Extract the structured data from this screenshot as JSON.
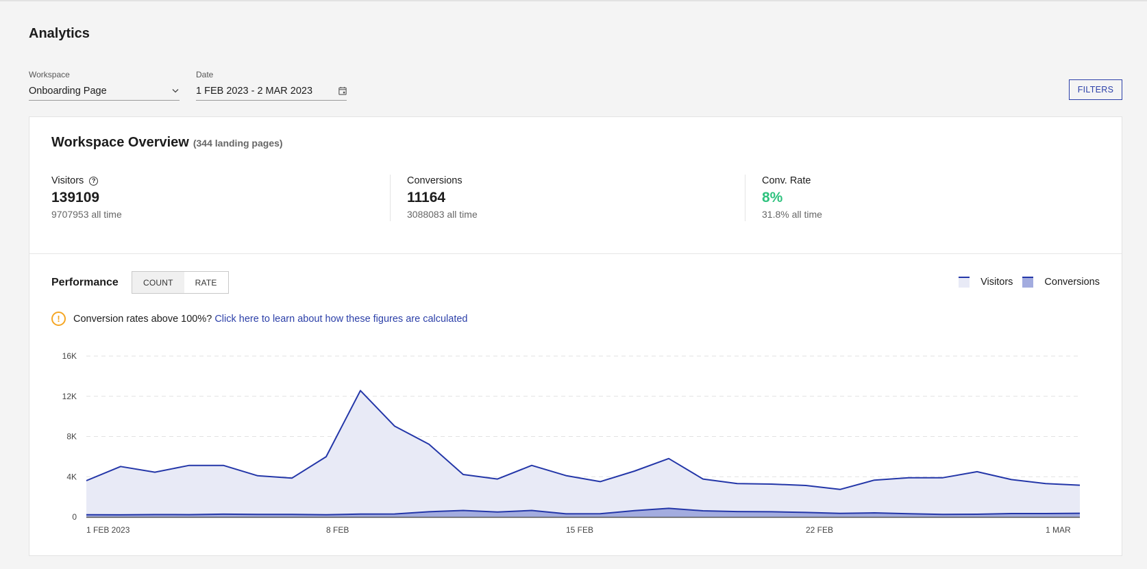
{
  "header": {
    "title": "Analytics"
  },
  "filters": {
    "workspace": {
      "label": "Workspace",
      "value": "Onboarding Page",
      "icon": "chevron-down-icon"
    },
    "date": {
      "label": "Date",
      "value": "1 FEB 2023 - 2 MAR 2023",
      "icon": "calendar-icon"
    },
    "filters_button": "FILTERS"
  },
  "overview": {
    "title": "Workspace Overview",
    "subtitle": "(344 landing pages)",
    "stats": [
      {
        "label": "Visitors",
        "value": "139109",
        "sub": "9707953 all time",
        "has_help": true
      },
      {
        "label": "Conversions",
        "value": "11164",
        "sub": "3088083 all time",
        "has_help": false
      },
      {
        "label": "Conv. Rate",
        "value": "8%",
        "sub": "31.8% all time",
        "has_help": false,
        "value_color": "#2ec27e"
      }
    ]
  },
  "performance": {
    "title": "Performance",
    "toggle": [
      {
        "label": "COUNT",
        "active": true
      },
      {
        "label": "RATE",
        "active": false
      }
    ],
    "legend": [
      {
        "label": "Visitors",
        "fill": "#e8eaf6",
        "stroke": "#2336a8"
      },
      {
        "label": "Conversions",
        "fill": "#a3acdf",
        "stroke": "#2336a8"
      }
    ],
    "warning": {
      "text": "Conversion rates above 100%?",
      "link": "Click here to learn about how these figures are calculated"
    }
  },
  "chart_data": {
    "type": "area",
    "title": "",
    "xlabel": "",
    "ylabel": "",
    "x": [
      "1 Feb",
      "2 Feb",
      "3 Feb",
      "4 Feb",
      "5 Feb",
      "6 Feb",
      "7 Feb",
      "8 Feb",
      "9 Feb",
      "10 Feb",
      "11 Feb",
      "12 Feb",
      "13 Feb",
      "14 Feb",
      "15 Feb",
      "16 Feb",
      "17 Feb",
      "18 Feb",
      "19 Feb",
      "20 Feb",
      "21 Feb",
      "22 Feb",
      "23 Feb",
      "24 Feb",
      "25 Feb",
      "26 Feb",
      "27 Feb",
      "28 Feb",
      "1 Mar",
      "2 Mar"
    ],
    "x_tick_labels": [
      {
        "index": 0,
        "label": "1 FEB 2023"
      },
      {
        "index": 7,
        "label": "8 FEB"
      },
      {
        "index": 14,
        "label": "15 FEB"
      },
      {
        "index": 21,
        "label": "22 FEB"
      },
      {
        "index": 28,
        "label": "1 MAR"
      }
    ],
    "y_ticks": [
      0,
      4000,
      8000,
      12000,
      16000
    ],
    "y_tick_labels": [
      "0",
      "4K",
      "8K",
      "12K",
      "16K"
    ],
    "ylim": [
      0,
      16000
    ],
    "grid": true,
    "legend_position": "top-right",
    "series": [
      {
        "name": "Visitors",
        "values": [
          3610,
          5020,
          4450,
          5130,
          5130,
          4100,
          3860,
          5990,
          12570,
          9030,
          7240,
          4220,
          3770,
          5130,
          4110,
          3510,
          4560,
          5810,
          3770,
          3320,
          3270,
          3130,
          2740,
          3660,
          3900,
          3900,
          4500,
          3720,
          3320,
          3160
        ]
      },
      {
        "name": "Conversions",
        "values": [
          220,
          210,
          240,
          230,
          280,
          250,
          250,
          220,
          290,
          300,
          520,
          650,
          500,
          650,
          310,
          320,
          630,
          860,
          610,
          540,
          520,
          450,
          360,
          410,
          320,
          250,
          270,
          340,
          340,
          370
        ]
      }
    ]
  }
}
